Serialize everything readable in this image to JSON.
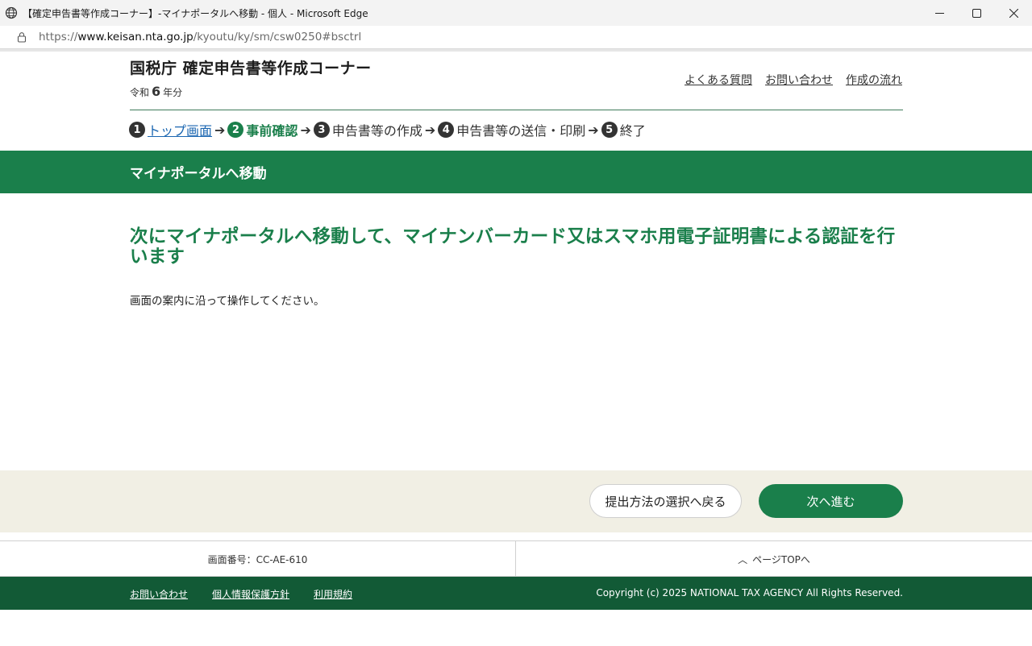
{
  "browser": {
    "window_title": "【確定申告書等作成コーナー】-マイナポータルへ移動 - 個人 - Microsoft Edge",
    "url_prefix": "https://",
    "url_domain": "www.keisan.nta.go.jp",
    "url_path": "/kyoutu/ky/sm/csw0250#bsctrl"
  },
  "header": {
    "site_title": "国税庁 確定申告書等作成コーナー",
    "era_prefix": "令和",
    "era_number": "6",
    "era_suffix": "年分",
    "links": [
      "よくある質問",
      "お問い合わせ",
      "作成の流れ"
    ]
  },
  "steps": [
    {
      "num": "1",
      "label": "トップ画面"
    },
    {
      "num": "2",
      "label": "事前確認"
    },
    {
      "num": "3",
      "label": "申告書等の作成"
    },
    {
      "num": "4",
      "label": "申告書等の送信・印刷"
    },
    {
      "num": "5",
      "label": "終了"
    }
  ],
  "band_title": "マイナポータルへ移動",
  "main": {
    "headline": "次にマイナポータルへ移動して、マイナンバーカード又はスマホ用電子証明書による認証を行います",
    "instruction": "画面の案内に沿って操作してください。"
  },
  "actions": {
    "back_label": "提出方法の選択へ戻る",
    "next_label": "次へ進む"
  },
  "footer": {
    "screen_id": "画面番号：CC-AE-610",
    "page_top": "ページTOPへ",
    "links": [
      "お問い合わせ",
      "個人情報保護方針",
      "利用規約"
    ],
    "copyright": "Copyright (c) 2025 NATIONAL TAX AGENCY All Rights Reserved."
  },
  "colors": {
    "brand_green": "#1a7f4b",
    "footer_green": "#125a36",
    "action_bar_bg": "#f1efe4"
  }
}
